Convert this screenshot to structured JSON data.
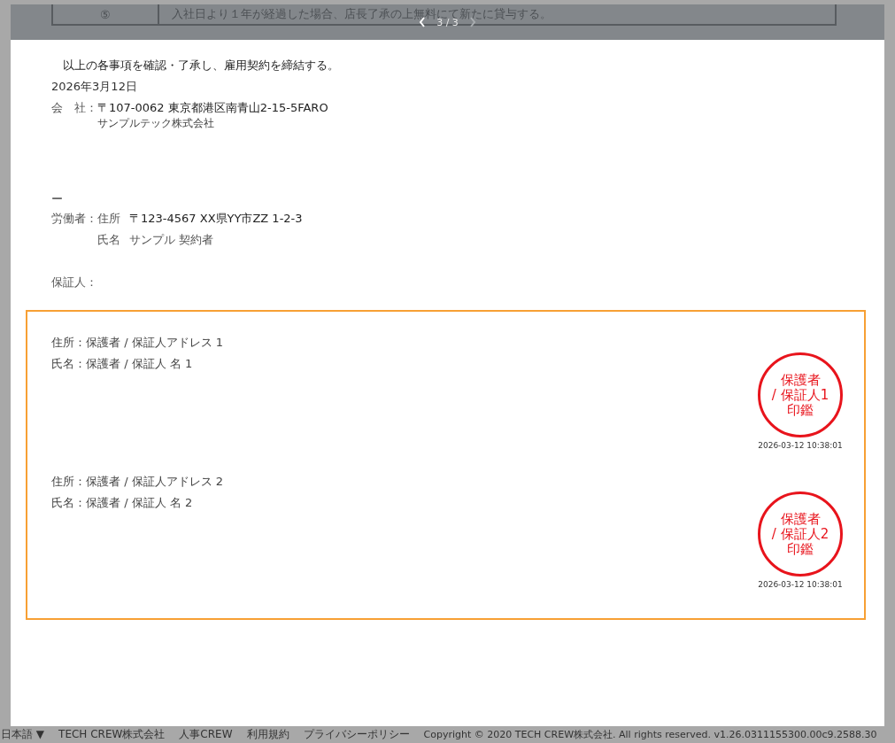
{
  "viewer": {
    "pager": {
      "label": "3 / 3",
      "prev_disabled": false,
      "next_disabled": true
    }
  },
  "document": {
    "table_row": {
      "number": "⑤",
      "text": "入社日より１年が経過した場合、店長了承の上無料にて新たに貸与する。"
    },
    "agreement": "以上の各事項を確認・了承し、雇用契約を締結する。",
    "date": "2026年3月12日",
    "company": {
      "label": "会　社：",
      "address": "〒107-0062 東京都港区南青山2-15-5FARO",
      "name": "サンプルテック株式会社"
    },
    "dash": "ー",
    "worker": {
      "label": "労働者：",
      "address_label": "住所",
      "address": "〒123-4567 XX県YY市ZZ 1-2-3",
      "name_label": "氏名",
      "name": "サンプル 契約者"
    },
    "guarantor_label": "保証人：",
    "guarantors": [
      {
        "address": "住所：保護者 / 保証人アドレス 1",
        "name": "氏名：保護者 / 保証人 名 1",
        "seal": [
          "保護者",
          "/ 保証人1",
          "印鑑"
        ],
        "timestamp": "2026-03-12 10:38:01"
      },
      {
        "address": "住所：保護者 / 保証人アドレス 2",
        "name": "氏名：保護者 / 保証人 名 2",
        "seal": [
          "保護者",
          "/ 保証人2",
          "印鑑"
        ],
        "timestamp": "2026-03-12 10:38:01"
      }
    ]
  },
  "footer": {
    "language": "日本語 ▼",
    "links": [
      "TECH CREW株式会社",
      "人事CREW",
      "利用規約",
      "プライバシーポリシー"
    ],
    "copyright": "Copyright © 2020 TECH CREW株式会社. All rights reserved. v1.26.0311155300.00c9.2588.30"
  }
}
